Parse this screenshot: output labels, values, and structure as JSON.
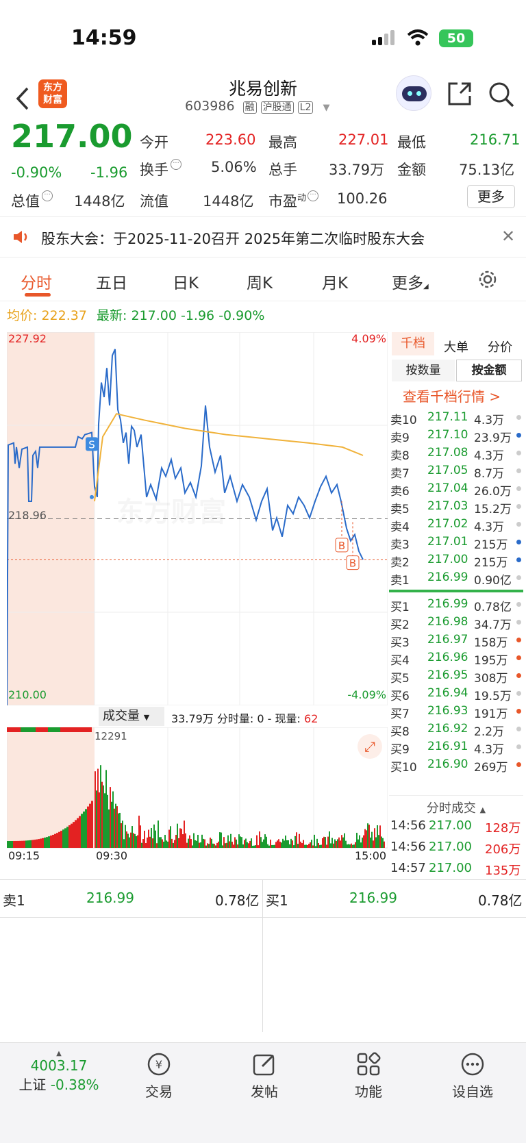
{
  "status": {
    "time": "14:59",
    "battery": "50"
  },
  "header": {
    "title": "兆易创新",
    "code": "603986",
    "badges": [
      "融",
      "沪股通",
      "L2"
    ],
    "logo_line1": "东方",
    "logo_line2": "财富"
  },
  "quote": {
    "price": "217.00",
    "pct": "-0.90%",
    "chg": "-1.96",
    "open_label": "今开",
    "open": "223.60",
    "high_label": "最高",
    "high": "227.01",
    "low_label": "最低",
    "low": "216.71",
    "turnover_label": "换手",
    "turnover": "5.06%",
    "vol_label": "总手",
    "vol": "33.79万",
    "amt_label": "金额",
    "amt": "75.13亿",
    "mcap_label": "总值",
    "mcap": "1448亿",
    "float_label": "流值",
    "float": "1448亿",
    "pe_label": "市盈",
    "pe_sup": "动",
    "pe": "100.26",
    "more": "更多"
  },
  "notice": {
    "text": "股东大会：于2025-11-20召开 2025年第二次临时股东大会"
  },
  "tabs": [
    "分时",
    "五日",
    "日K",
    "周K",
    "月K",
    "更多"
  ],
  "info": {
    "avg_label": "均价:",
    "avg": "222.37",
    "last_label": "最新:",
    "last": "217.00",
    "chg": "-1.96",
    "pct": "-0.90%"
  },
  "chart_data": {
    "type": "line",
    "ylim": [
      210.0,
      227.92
    ],
    "y_ref": 218.96,
    "y_top_label": "227.92",
    "y_bottom_label": "210.00",
    "ref_label": "218.96",
    "pct_top": "4.09%",
    "pct_bottom": "-4.09%",
    "markers": [
      "S",
      "B",
      "B"
    ],
    "vol_title": "成交量",
    "vol_summary": "33.79万",
    "vol_min_label": "分时量:",
    "vol_min": "0",
    "vol_now_label": "现量:",
    "vol_now": "62",
    "vol_peak": "12291",
    "x_labels": [
      "09:15",
      "09:30",
      "15:00"
    ]
  },
  "book": {
    "tabs": [
      "千档",
      "大单",
      "分价"
    ],
    "sub": [
      "按数量",
      "按金额"
    ],
    "link": "查看千档行情 >",
    "asks": [
      [
        "卖10",
        "217.11",
        "4.3万"
      ],
      [
        "卖9",
        "217.10",
        "23.9万"
      ],
      [
        "卖8",
        "217.08",
        "4.3万"
      ],
      [
        "卖7",
        "217.05",
        "8.7万"
      ],
      [
        "卖6",
        "217.04",
        "26.0万"
      ],
      [
        "卖5",
        "217.03",
        "15.2万"
      ],
      [
        "卖4",
        "217.02",
        "4.3万"
      ],
      [
        "卖3",
        "217.01",
        "215万"
      ],
      [
        "卖2",
        "217.00",
        "215万"
      ],
      [
        "卖1",
        "216.99",
        "0.90亿"
      ]
    ],
    "bids": [
      [
        "买1",
        "216.99",
        "0.78亿"
      ],
      [
        "买2",
        "216.98",
        "34.7万"
      ],
      [
        "买3",
        "216.97",
        "158万"
      ],
      [
        "买4",
        "216.96",
        "195万"
      ],
      [
        "买5",
        "216.95",
        "308万"
      ],
      [
        "买6",
        "216.94",
        "19.5万"
      ],
      [
        "买7",
        "216.93",
        "191万"
      ],
      [
        "买8",
        "216.92",
        "2.2万"
      ],
      [
        "买9",
        "216.91",
        "4.3万"
      ],
      [
        "买10",
        "216.90",
        "269万"
      ]
    ],
    "ticks_title": "分时成交",
    "ticks": [
      [
        "14:56",
        "217.00",
        "128万"
      ],
      [
        "14:56",
        "217.00",
        "206万"
      ],
      [
        "14:57",
        "217.00",
        "135万"
      ]
    ]
  },
  "level": {
    "sell_label": "卖1",
    "sell_price": "216.99",
    "sell_amt": "0.78亿",
    "buy_label": "买1",
    "buy_price": "216.99",
    "buy_amt": "0.78亿"
  },
  "nav": {
    "index_value": "4003.17",
    "index_name": "上证",
    "index_pct": "-0.38%",
    "items": [
      "交易",
      "发帖",
      "功能",
      "设自选"
    ]
  },
  "watermark": "东方财富"
}
